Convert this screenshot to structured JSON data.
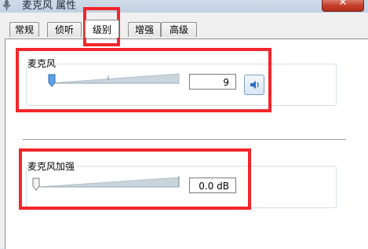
{
  "window": {
    "title": "麦克风 属性",
    "close_glyph": "✕"
  },
  "tabs": [
    {
      "label": "常规",
      "active": false
    },
    {
      "label": "侦听",
      "active": false
    },
    {
      "label": "级别",
      "active": true
    },
    {
      "label": "增强",
      "active": false
    },
    {
      "label": "高级",
      "active": false
    }
  ],
  "levels": {
    "microphone": {
      "label": "麦克风",
      "value": "9",
      "slider_fraction": 0.09,
      "mute_icon": "speaker-icon"
    },
    "boost": {
      "label": "麦克风加强",
      "value": "0.0 dB",
      "slider_fraction": 0.0
    }
  },
  "colors": {
    "highlight_red": "#f2262b",
    "titlebar": "#c8d6e5",
    "close_red": "#c5402b"
  }
}
